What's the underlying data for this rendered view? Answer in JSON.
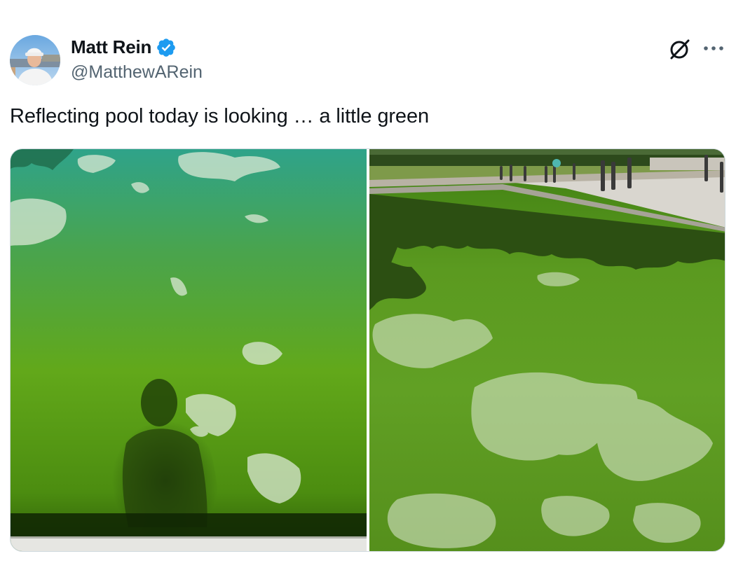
{
  "author": {
    "display_name": "Matt Rein",
    "handle": "@MatthewARein",
    "verified": true,
    "avatar_icon": "avatar-photo"
  },
  "tweet": {
    "text": "Reflecting pool today is looking … a little green"
  },
  "actions": {
    "grok_icon": "grok-icon",
    "more_icon": "more-options-icon"
  },
  "media": {
    "photos": [
      {
        "icon": "green-water-shadow-photo"
      },
      {
        "icon": "reflecting-pool-photo"
      }
    ]
  },
  "colors": {
    "text_primary": "#0f1419",
    "text_secondary": "#536471",
    "verified_blue": "#1d9bf0",
    "border": "#cfd9de",
    "water_green": "#5a9a1c"
  }
}
